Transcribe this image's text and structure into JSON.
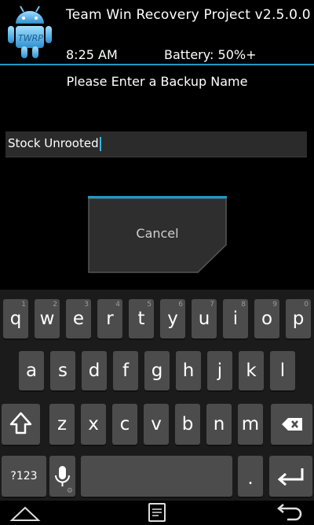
{
  "header": {
    "title": "Team Win Recovery Project  v2.5.0.0",
    "time": "8:25 AM",
    "battery": "Battery: 50%+"
  },
  "dialog": {
    "prompt": "Please Enter a Backup Name",
    "input_value": "Stock Unrooted",
    "cancel_label": "Cancel"
  },
  "keyboard": {
    "row1": [
      {
        "key": "q",
        "hint": "1"
      },
      {
        "key": "w",
        "hint": "2"
      },
      {
        "key": "e",
        "hint": "3"
      },
      {
        "key": "r",
        "hint": "4"
      },
      {
        "key": "t",
        "hint": "5"
      },
      {
        "key": "y",
        "hint": "6"
      },
      {
        "key": "u",
        "hint": "7"
      },
      {
        "key": "i",
        "hint": "8"
      },
      {
        "key": "o",
        "hint": "9"
      },
      {
        "key": "p",
        "hint": "0"
      }
    ],
    "row2": [
      "a",
      "s",
      "d",
      "f",
      "g",
      "h",
      "j",
      "k",
      "l"
    ],
    "row3": [
      "z",
      "x",
      "c",
      "v",
      "b",
      "n",
      "m"
    ],
    "symbols_label": "?123",
    "period_label": "."
  },
  "colors": {
    "accent": "#1f9bc3",
    "key": "#4c4c4c",
    "background": "#000000"
  }
}
